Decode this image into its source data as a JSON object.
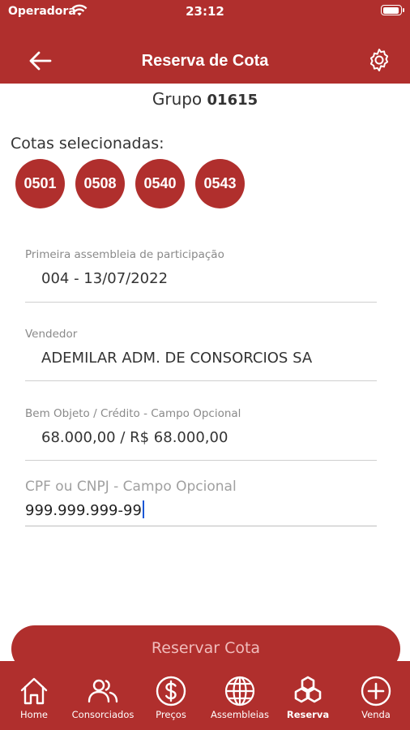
{
  "status_bar": {
    "carrier": "Operadora",
    "time": "23:12"
  },
  "nav": {
    "title": "Reserva de Cota",
    "back_icon": "arrow-left-icon",
    "settings_icon": "gear-icon"
  },
  "group": {
    "label": "Grupo",
    "number": "01615"
  },
  "cotas": {
    "label": "Cotas selecionadas:",
    "items": [
      "0501",
      "0508",
      "0540",
      "0543"
    ]
  },
  "fields": {
    "assembleia": {
      "label": "Primeira assembleia de participação",
      "value": "004 - 13/07/2022"
    },
    "vendedor": {
      "label": "Vendedor",
      "value": "ADEMILAR ADM. DE CONSORCIOS SA"
    },
    "bem": {
      "label": "Bem Objeto / Crédito - Campo Opcional",
      "value": "68.000,00 / R$ 68.000,00"
    },
    "cpf": {
      "label": "CPF ou CNPJ - Campo Opcional",
      "value": "999.999.999-99"
    }
  },
  "reserve_button": {
    "label": "Reservar Cota"
  },
  "tabs": [
    {
      "label": "Home",
      "icon": "home-icon"
    },
    {
      "label": "Consorciados",
      "icon": "users-icon"
    },
    {
      "label": "Preços",
      "icon": "dollar-icon"
    },
    {
      "label": "Assembleias",
      "icon": "globe-icon"
    },
    {
      "label": "Reserva",
      "icon": "reserve-icon",
      "active": true
    },
    {
      "label": "Venda",
      "icon": "plus-circle-icon"
    }
  ],
  "colors": {
    "brand_red": "#b02f2d",
    "white": "#ffffff",
    "caret_blue": "#1a57d6"
  }
}
